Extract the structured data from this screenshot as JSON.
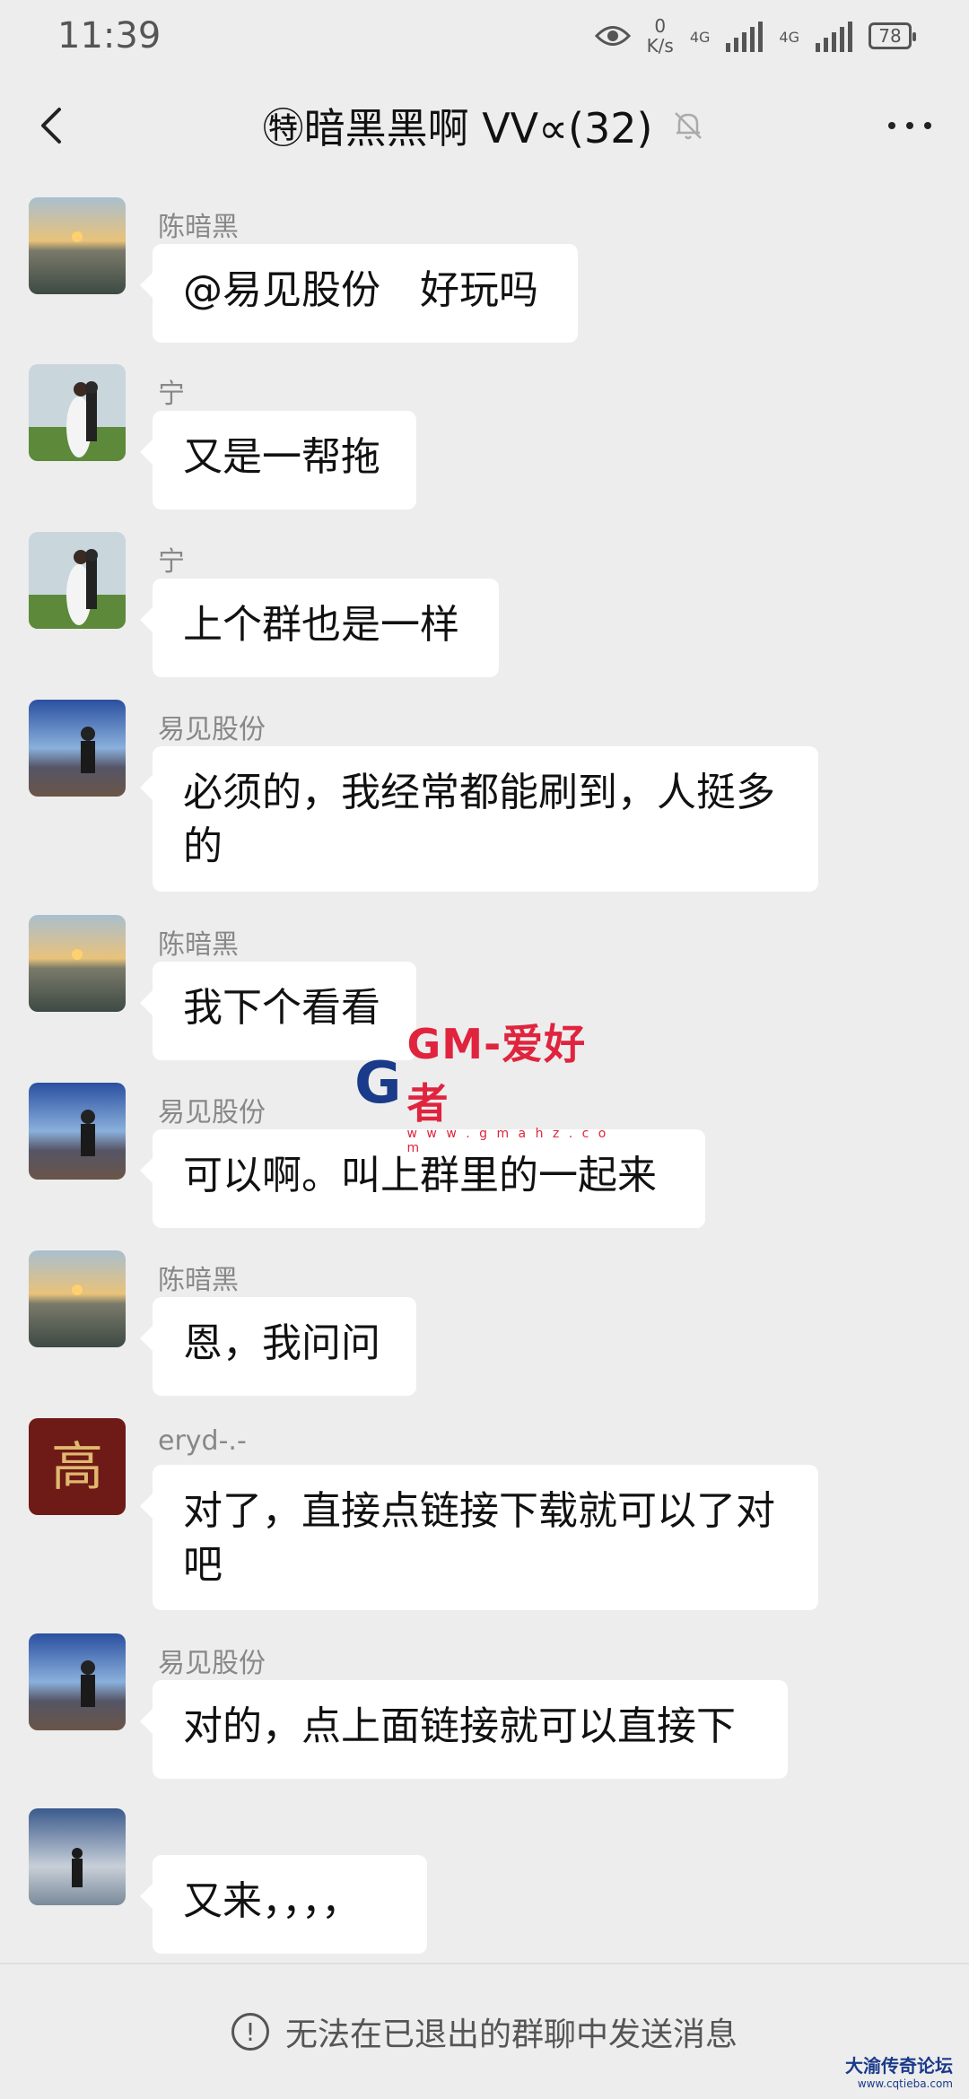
{
  "status_bar": {
    "time": "11:39",
    "net_speed_value": "0",
    "net_speed_unit": "K/s",
    "network1": "4G",
    "network2": "4G",
    "battery": "78"
  },
  "nav": {
    "title": "㊕暗黑黑啊 VV∝(32)"
  },
  "messages": [
    {
      "sender": "陈暗黑",
      "lines": [
        "@易见股份　好玩吗"
      ],
      "avatar": "sunset-sea"
    },
    {
      "sender": "宁",
      "lines": [
        "又是一帮拖"
      ],
      "avatar": "wedding"
    },
    {
      "sender": "宁",
      "lines": [
        "上个群也是一样"
      ],
      "avatar": "wedding"
    },
    {
      "sender": "易见股份",
      "lines": [
        "必须的，我经常都能刷到，人挺多",
        "的"
      ],
      "avatar": "person-seaside"
    },
    {
      "sender": "陈暗黑",
      "lines": [
        "我下个看看"
      ],
      "avatar": "sunset-sea"
    },
    {
      "sender": "易见股份",
      "lines": [
        "可以啊。叫上群里的一起来"
      ],
      "avatar": "person-seaside"
    },
    {
      "sender": "陈暗黑",
      "lines": [
        "恩，我问问"
      ],
      "avatar": "sunset-sea"
    },
    {
      "sender": "eryd-.-",
      "lines": [
        "对了，直接点链接下载就可以了对",
        "吧"
      ],
      "avatar": "calligraphy-gao"
    },
    {
      "sender": "易见股份",
      "lines": [
        "对的，点上面链接就可以直接下"
      ],
      "avatar": "person-seaside"
    },
    {
      "sender": "",
      "lines": [
        "又来，，，，"
      ],
      "avatar": "silhouette-dusk"
    }
  ],
  "watermark": {
    "letter": "G",
    "text": "GM-爱好者",
    "url": "w w w . g m a h z . c o m"
  },
  "bottom_bar": {
    "notice": "无法在已退出的群聊中发送消息"
  },
  "forum_logo": {
    "name": "大渝传奇论坛",
    "url": "www.cqtieba.com"
  },
  "avatar_glyph": "高"
}
